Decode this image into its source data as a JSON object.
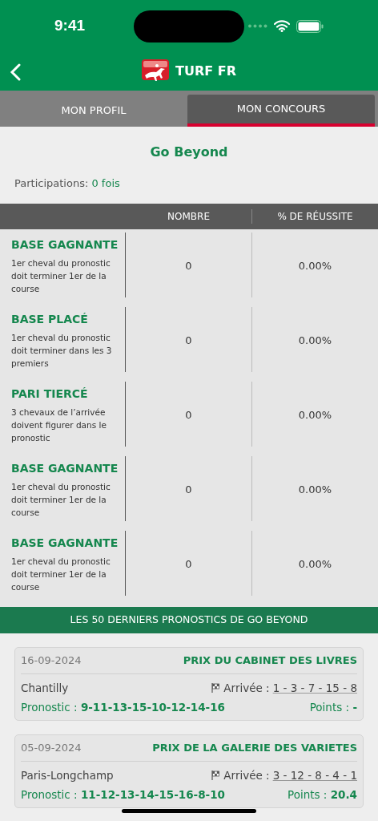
{
  "status_bar": {
    "time": "9:41"
  },
  "header": {
    "title": "TURF FR"
  },
  "tabs": [
    {
      "label": "MON PROFIL",
      "selected": false
    },
    {
      "label": "MON CONCOURS",
      "selected": true
    }
  ],
  "profile": {
    "name": "Go Beyond",
    "participations_label": "Participations:",
    "participations_value": "0 fois"
  },
  "table": {
    "columns": [
      "NOMBRE",
      "% DE RÉUSSITE"
    ],
    "rows": [
      {
        "title": "BASE GAGNANTE",
        "description": "1er cheval du pronostic doit terminer 1er de la course",
        "count": "0",
        "rate": "0.00%"
      },
      {
        "title": "BASE PLACÉ",
        "description": "1er cheval du pronostic doit terminer dans les 3 premiers",
        "count": "0",
        "rate": "0.00%"
      },
      {
        "title": "PARI TIERCÉ",
        "description": "3 chevaux de l’arrivée doivent figurer dans le pronostic",
        "count": "0",
        "rate": "0.00%"
      },
      {
        "title": "BASE GAGNANTE",
        "description": "1er cheval du pronostic doit terminer 1er de la course",
        "count": "0",
        "rate": "0.00%"
      },
      {
        "title": "BASE GAGNANTE",
        "description": "1er cheval du pronostic doit terminer 1er de la course",
        "count": "0",
        "rate": "0.00%"
      }
    ]
  },
  "history": {
    "title": "LES 50 DERNIERS PRONOSTICS DE GO BEYOND",
    "cards": [
      {
        "date": "16-09-2024",
        "race": "PRIX DU CABINET DES LIVRES",
        "venue": "Chantilly",
        "arrival_label": "Arrivée :",
        "arrival": "1 - 3 - 7 - 15 - 8",
        "pronostic": "Pronostic : **9-11-13-15-10-12-14-16**",
        "points": "Points : **-**"
      },
      {
        "date": "05-09-2024",
        "race": "PRIX DE LA GALERIE DES VARIETES",
        "venue": "Paris-Longchamp",
        "arrival_label": "Arrivée :",
        "arrival": "3 - 12 - 8 - 4 - 1",
        "pronostic": "Pronostic : **11-12-13-14-15-16-8-10**",
        "points": "Points : **20.4**"
      }
    ]
  }
}
